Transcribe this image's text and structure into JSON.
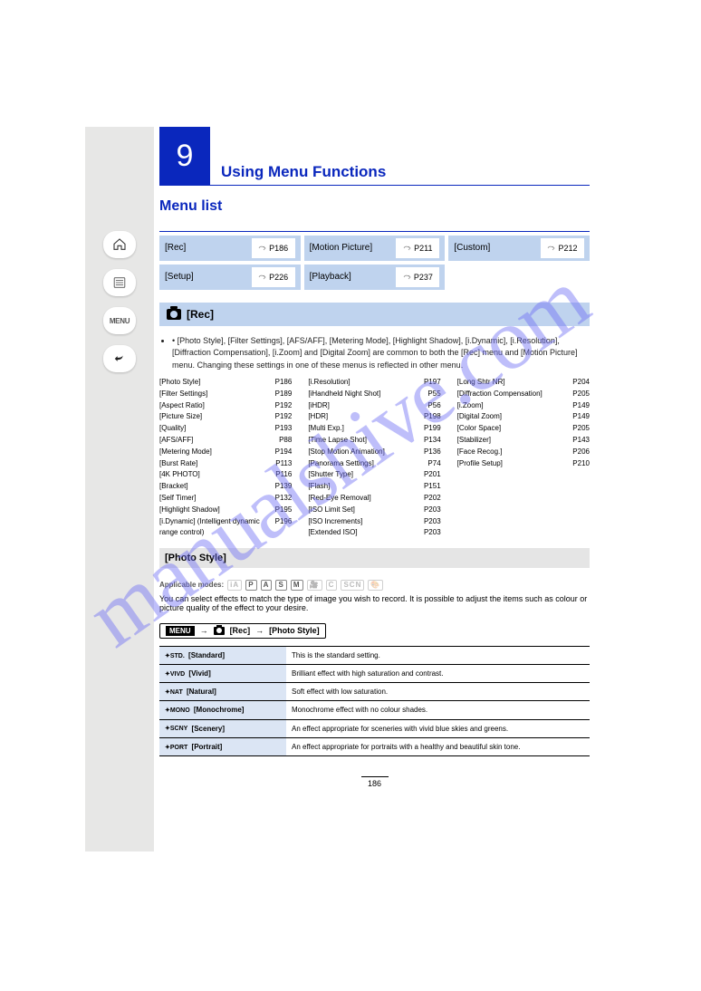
{
  "watermark": "manualshive.com",
  "chapter": {
    "number": "9",
    "title": "Using Menu Functions",
    "subtitle": ""
  },
  "menu_list_heading": "Menu list",
  "menu_links": [
    {
      "label": "[Rec]",
      "page": "P186"
    },
    {
      "label": "[Motion Picture]",
      "page": "P211"
    },
    {
      "label": "[Custom]",
      "page": "P212"
    },
    {
      "label": "[Setup]",
      "page": "P226"
    },
    {
      "label": "[Playback]",
      "page": "P237"
    }
  ],
  "rec_section_title": "[Rec]",
  "rec_intro": [
    "• [Photo Style], [Filter Settings], [AFS/AFF], [Metering Mode], [Highlight Shadow], [i.Dynamic], [i.Resolution], [Diffraction Compensation], [i.Zoom] and [Digital Zoom] are common to both the [Rec] menu and [Motion Picture] menu. Changing these settings in one of these menus is reflected in other menu."
  ],
  "rec_columns_left": [
    {
      "lbl": "[Photo Style]",
      "pg": "P186"
    },
    {
      "lbl": "[Filter Settings]",
      "pg": "P189"
    },
    {
      "lbl": "[Aspect Ratio]",
      "pg": "P192"
    },
    {
      "lbl": "[Picture Size]",
      "pg": "P192"
    },
    {
      "lbl": "[Quality]",
      "pg": "P193"
    },
    {
      "lbl": "[AFS/AFF]",
      "pg": "P88"
    },
    {
      "lbl": "[Metering Mode]",
      "pg": "P194"
    },
    {
      "lbl": "[Burst Rate]",
      "pg": "P113"
    },
    {
      "lbl": "[4K PHOTO]",
      "pg": "P116"
    },
    {
      "lbl": "[Bracket]",
      "pg": "P139"
    },
    {
      "lbl": "[Self Timer]",
      "pg": "P132"
    },
    {
      "lbl": "[Highlight Shadow]",
      "pg": "P195"
    },
    {
      "lbl": "[i.Dynamic] (Intelligent dynamic range control)",
      "pg": "P196"
    }
  ],
  "rec_columns_mid": [
    {
      "lbl": "[i.Resolution]",
      "pg": "P197"
    },
    {
      "lbl": "[iHandheld Night Shot]",
      "pg": "P55"
    },
    {
      "lbl": "[iHDR]",
      "pg": "P56"
    },
    {
      "lbl": "[HDR]",
      "pg": "P198"
    },
    {
      "lbl": "[Multi Exp.]",
      "pg": "P199"
    },
    {
      "lbl": "[Time Lapse Shot]",
      "pg": "P134"
    },
    {
      "lbl": "[Stop Motion Animation]",
      "pg": "P136"
    },
    {
      "lbl": "[Panorama Settings]",
      "pg": "P74"
    },
    {
      "lbl": "[Shutter Type]",
      "pg": "P201"
    },
    {
      "lbl": "[Flash]",
      "pg": "P151"
    },
    {
      "lbl": "[Red-Eye Removal]",
      "pg": "P202"
    },
    {
      "lbl": "[ISO Limit Set]",
      "pg": "P203"
    },
    {
      "lbl": "[ISO Increments]",
      "pg": "P203"
    },
    {
      "lbl": "[Extended ISO]",
      "pg": "P203"
    }
  ],
  "rec_columns_right": [
    {
      "lbl": "[Long Shtr NR]",
      "pg": "P204"
    },
    {
      "lbl": "[Diffraction Compensation]",
      "pg": "P205"
    },
    {
      "lbl": "[i.Zoom]",
      "pg": "P149"
    },
    {
      "lbl": "[Digital Zoom]",
      "pg": "P149"
    },
    {
      "lbl": "[Color Space]",
      "pg": "P205"
    },
    {
      "lbl": "[Stabilizer]",
      "pg": "P143"
    },
    {
      "lbl": "[Face Recog.]",
      "pg": "P206"
    },
    {
      "lbl": "[Profile Setup]",
      "pg": "P210"
    }
  ],
  "photo_style_heading": "[Photo Style]",
  "modes_label": "Applicable modes:",
  "photo_style_desc": "You can select effects to match the type of image you wish to record. It is possible to adjust the items such as colour or picture quality of the effect to your desire.",
  "menu_path": {
    "menu": "MENU",
    "section": "[Rec]",
    "item": "[Photo Style]"
  },
  "style_rows": [
    {
      "code": "STD.",
      "name": "[Standard]",
      "desc": "This is the standard setting."
    },
    {
      "code": "VIVD",
      "name": "[Vivid]",
      "desc": "Brilliant effect with high saturation and contrast."
    },
    {
      "code": "NAT",
      "name": "[Natural]",
      "desc": "Soft effect with low saturation."
    },
    {
      "code": "MONO",
      "name": "[Monochrome]",
      "desc": "Monochrome effect with no colour shades."
    },
    {
      "code": "SCNY",
      "name": "[Scenery]",
      "desc": "An effect appropriate for sceneries with vivid blue skies and greens."
    },
    {
      "code": "PORT",
      "name": "[Portrait]",
      "desc": "An effect appropriate for portraits with a healthy and beautiful skin tone."
    }
  ],
  "page_number": "186"
}
